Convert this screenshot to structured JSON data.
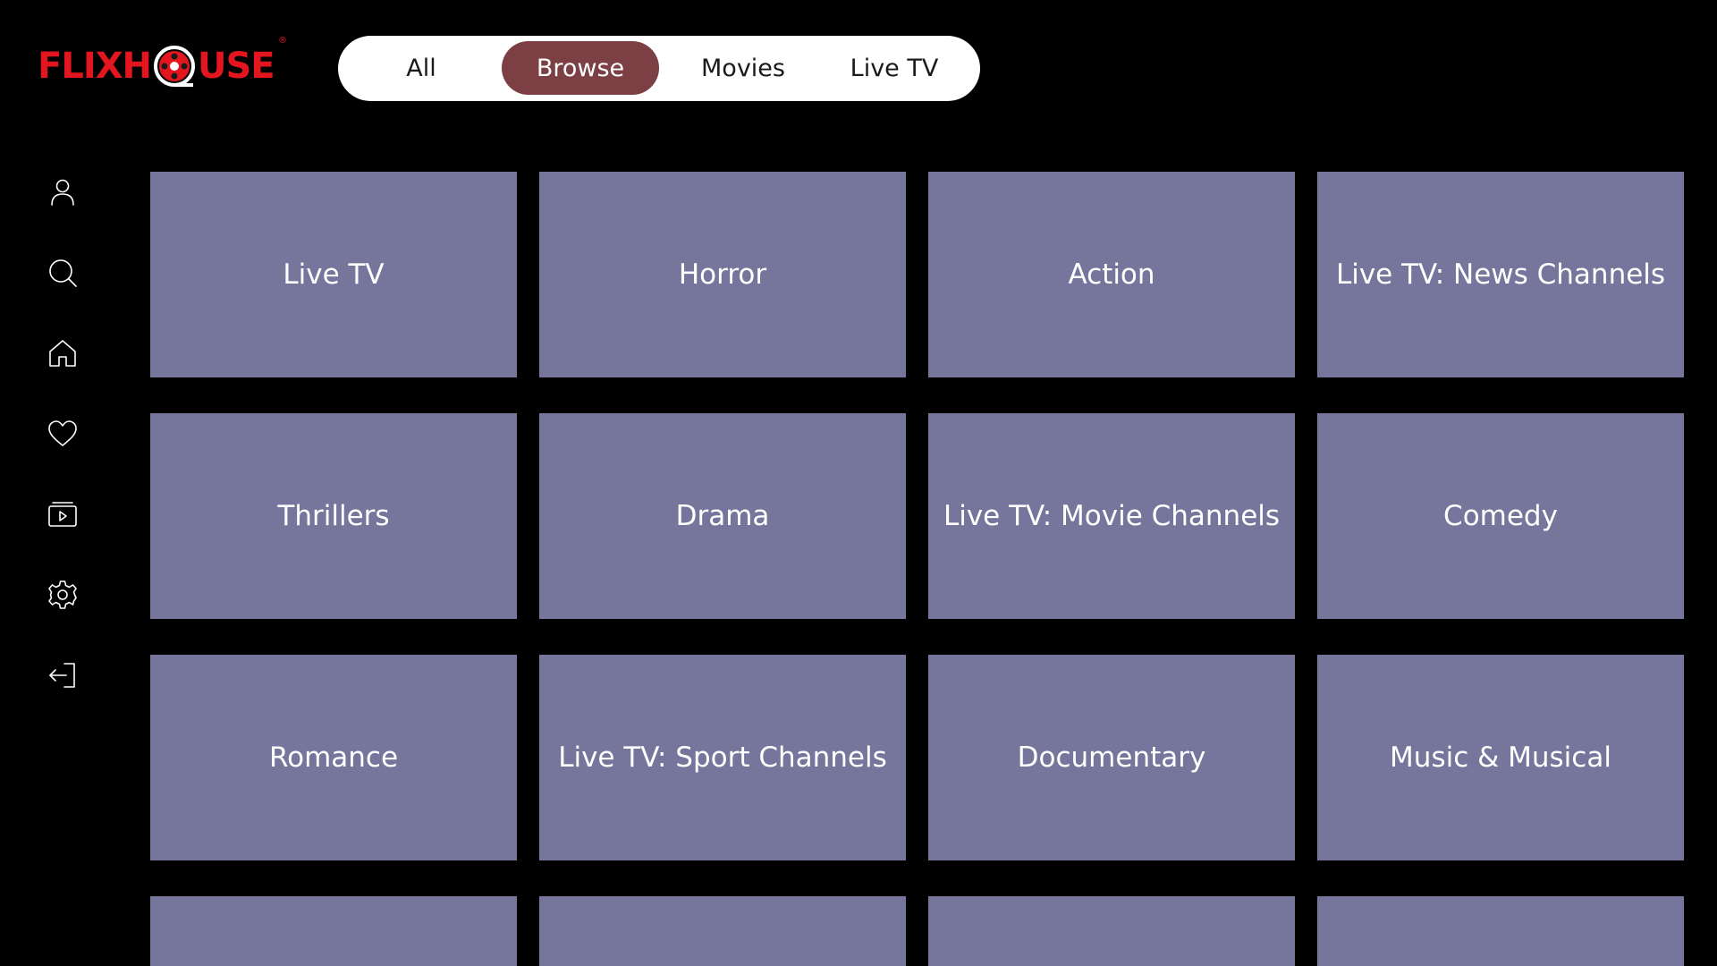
{
  "app": {
    "logo_text_a": "FLIXH",
    "logo_text_b": "USE",
    "logo_reg": "®",
    "brand_color": "#e3161f"
  },
  "tabs": [
    {
      "label": "All",
      "active": false
    },
    {
      "label": "Browse",
      "active": true
    },
    {
      "label": "Movies",
      "active": false
    },
    {
      "label": "Live TV",
      "active": false
    }
  ],
  "sidebar": {
    "icons": [
      "user-icon",
      "search-icon",
      "home-icon",
      "heart-icon",
      "play-library-icon",
      "settings-icon",
      "logout-icon"
    ]
  },
  "categories": [
    "Live TV",
    "Horror",
    "Action",
    "Live TV: News Channels",
    "Thrillers",
    "Drama",
    "Live TV: Movie Channels",
    "Comedy",
    "Romance",
    "Live TV: Sport Channels",
    "Documentary",
    "Music & Musical",
    "",
    "",
    "",
    ""
  ],
  "colors": {
    "background": "#000000",
    "tile": "#76759b",
    "active_tab": "#7b3f44",
    "tab_bar": "#ffffff"
  }
}
